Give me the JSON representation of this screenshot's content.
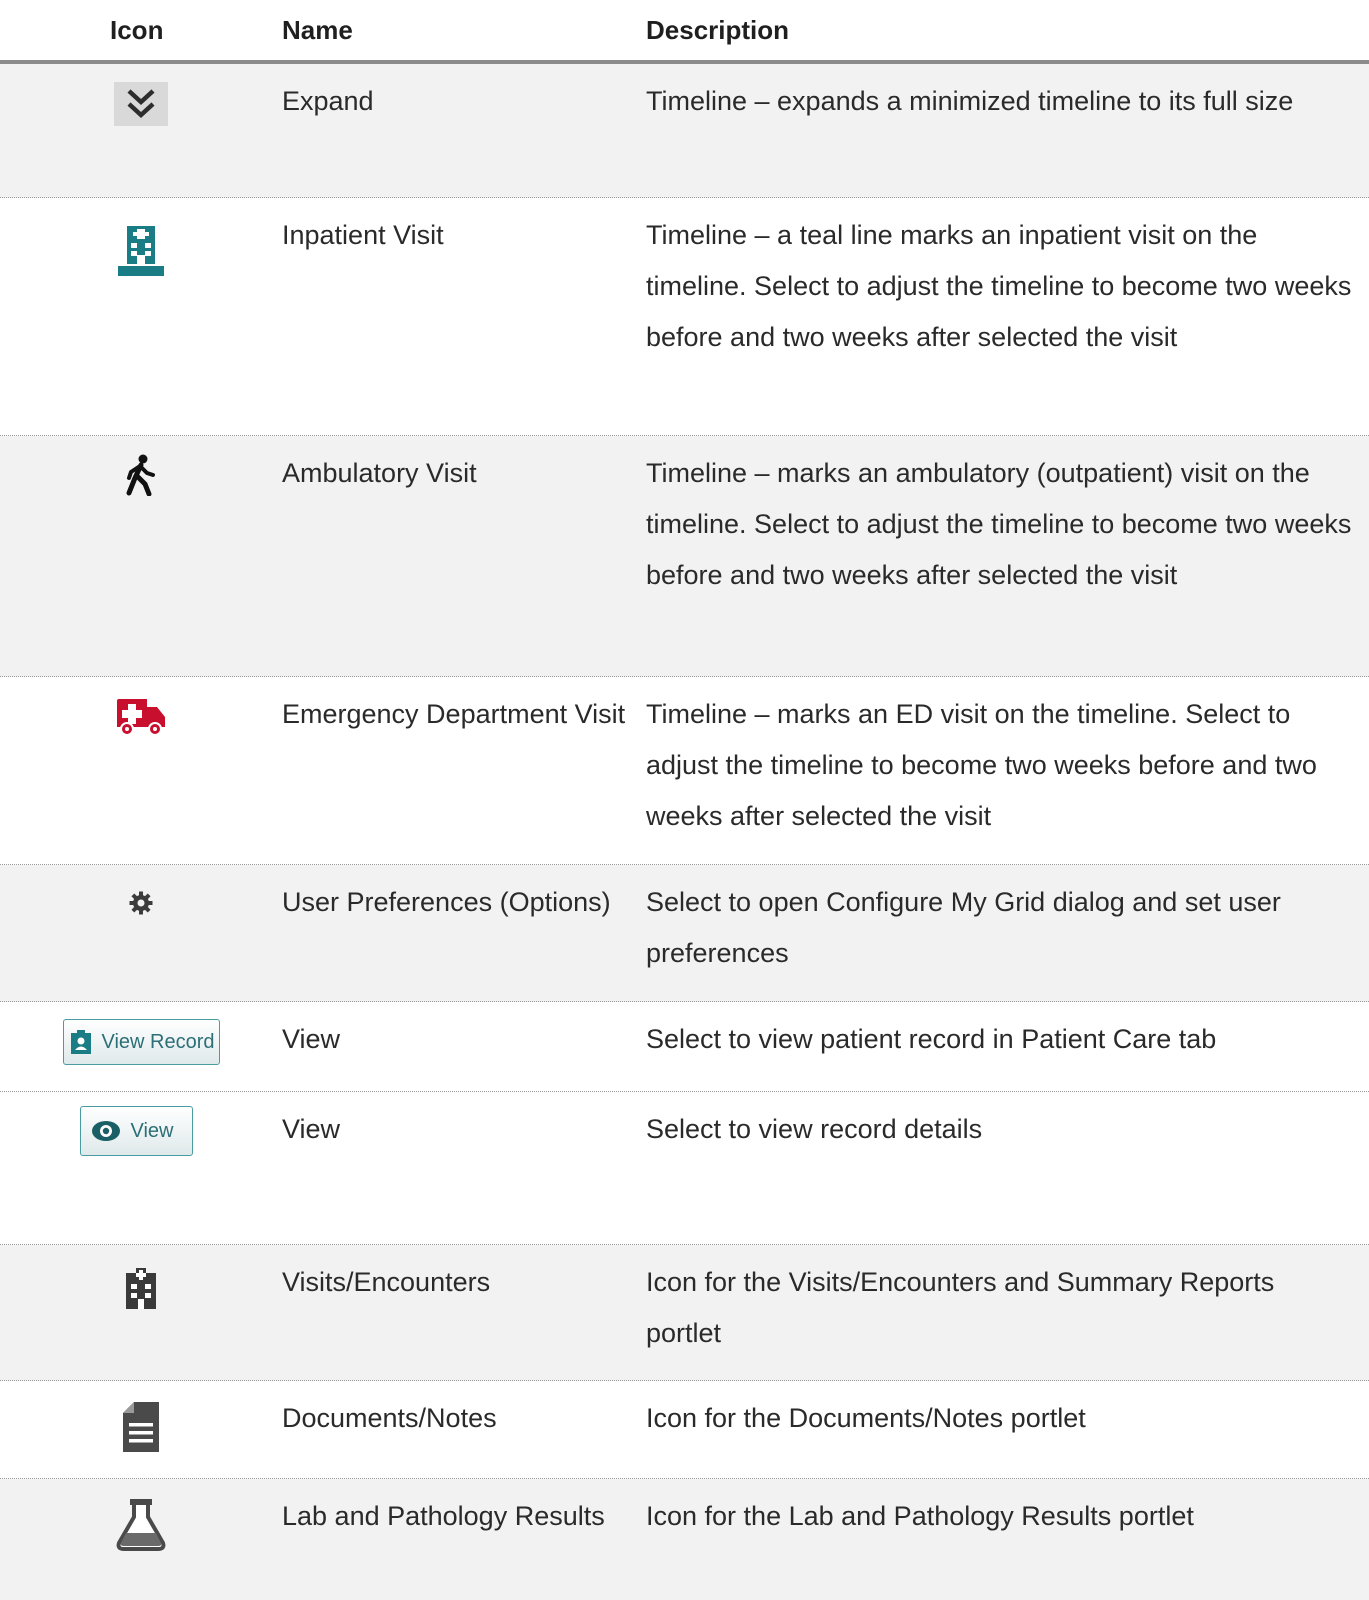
{
  "header": {
    "icon": "Icon",
    "name": "Name",
    "description": "Description"
  },
  "rows": [
    {
      "icon": "double-chevron-down-icon",
      "name": "Expand",
      "description": "Timeline – expands a minimized timeline to its full size"
    },
    {
      "icon": "hospital-building-icon",
      "name": "Inpatient Visit",
      "description": "Timeline – a teal line marks an inpatient visit on the timeline.  Select to adjust the timeline to become two weeks before and two weeks after selected the visit"
    },
    {
      "icon": "walking-person-icon",
      "name": "Ambulatory Visit",
      "description": "Timeline – marks an ambulatory (outpatient) visit on the timeline.  Select to adjust the timeline to become two weeks before and two weeks after selected the visit"
    },
    {
      "icon": "ambulance-icon",
      "name": "Emergency Department Visit",
      "description": "Timeline – marks an ED visit on the timeline. Select to adjust the timeline to become two weeks before and two weeks after selected the visit"
    },
    {
      "icon": "gear-icon",
      "name": "User Preferences (Options)",
      "description": "Select to open Configure My Grid dialog and set user preferences"
    },
    {
      "icon": "view-record-button",
      "button_label": "View Record",
      "name": "View",
      "description": "Select to view patient record in Patient Care tab"
    },
    {
      "icon": "view-button",
      "button_label": "View",
      "name": "View",
      "description": "Select to view record details"
    },
    {
      "icon": "building-icon",
      "name": "Visits/Encounters",
      "description": "Icon for the Visits/Encounters and Summary Reports portlet"
    },
    {
      "icon": "document-icon",
      "name": "Documents/Notes",
      "description": "Icon for the Documents/Notes portlet"
    },
    {
      "icon": "flask-icon",
      "name": "Lab and Pathology Results",
      "description": "Icon for the Lab and Pathology Results portlet"
    }
  ],
  "colors": {
    "teal": "#1a7d86",
    "ed_red": "#c8102e",
    "gray_icon": "#3c3c3c",
    "shade": "#f2f2f2"
  }
}
